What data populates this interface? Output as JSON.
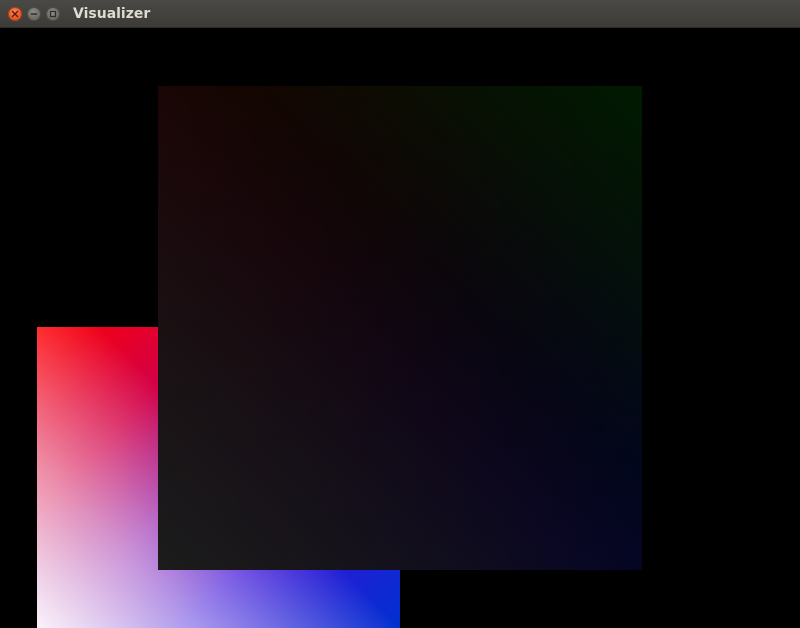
{
  "window": {
    "title": "Visualizer",
    "controls": {
      "close_icon": "close-icon",
      "minimize_icon": "minimize-icon",
      "maximize_icon": "maximize-icon"
    }
  },
  "scene": {
    "background": "#000000",
    "quads": [
      {
        "name": "bright-gradient-quad",
        "corner_colors": {
          "top_left": "#ff0000",
          "top_right": "#c06000",
          "bottom_left": "#ffe0e8",
          "bottom_right": "#0030d0"
        }
      },
      {
        "name": "dim-gradient-quad",
        "corner_colors": {
          "top_left": "#1c0000",
          "top_right": "#001a00",
          "bottom_left": "#1c1c1c",
          "bottom_right": "#00002a"
        }
      }
    ]
  }
}
